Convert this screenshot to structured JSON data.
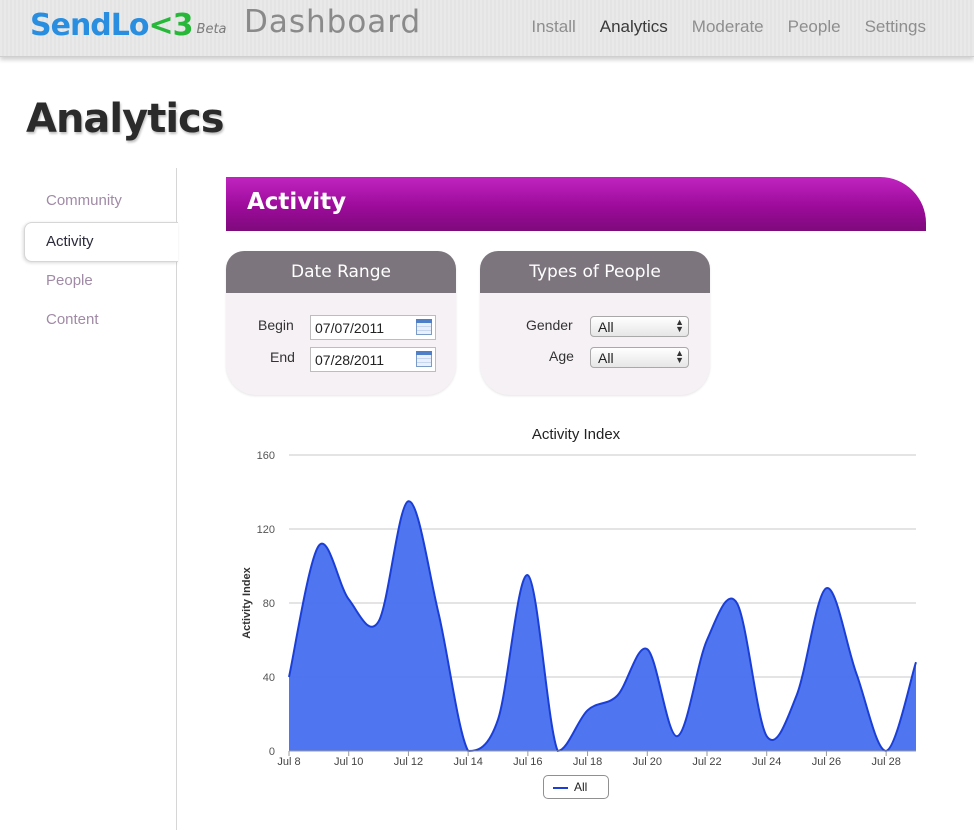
{
  "header": {
    "logo_text": "SendLo",
    "logo_heart": "<3",
    "logo_beta": "Beta",
    "app_title": "Dashboard",
    "nav": [
      {
        "label": "Install",
        "active": false
      },
      {
        "label": "Analytics",
        "active": true
      },
      {
        "label": "Moderate",
        "active": false
      },
      {
        "label": "People",
        "active": false
      },
      {
        "label": "Settings",
        "active": false
      }
    ]
  },
  "page": {
    "title": "Analytics"
  },
  "sidebar": {
    "items": [
      {
        "label": "Community",
        "active": false
      },
      {
        "label": "Activity",
        "active": true
      },
      {
        "label": "People",
        "active": false
      },
      {
        "label": "Content",
        "active": false
      }
    ]
  },
  "section": {
    "title": "Activity",
    "accent": "#9c0b9a"
  },
  "date_range": {
    "title": "Date Range",
    "begin_label": "Begin",
    "begin_value": "07/07/2011",
    "end_label": "End",
    "end_value": "07/28/2011",
    "icon": "calendar-icon"
  },
  "types_of_people": {
    "title": "Types of People",
    "gender_label": "Gender",
    "gender_value": "All",
    "age_label": "Age",
    "age_value": "All"
  },
  "chart_data": {
    "type": "area",
    "title": "Activity Index",
    "ylabel": "Activity Index",
    "xlabel": "",
    "ylim": [
      0,
      160
    ],
    "yticks": [
      0,
      40,
      80,
      120,
      160
    ],
    "xtick_labels": [
      "Jul 8",
      "Jul 10",
      "Jul 12",
      "Jul 14",
      "Jul 16",
      "Jul 18",
      "Jul 20",
      "Jul 22",
      "Jul 24",
      "Jul 26",
      "Jul 28"
    ],
    "x": [
      8,
      9,
      10,
      11,
      12,
      13,
      14,
      15,
      16,
      17,
      18,
      19,
      20,
      21,
      22,
      23,
      24,
      25,
      26,
      27,
      28,
      29
    ],
    "series": [
      {
        "name": "All",
        "color": "#4b72f0",
        "line_color": "#1b3fd6",
        "values": [
          40,
          111,
          82,
          70,
          135,
          75,
          0,
          17,
          95,
          0,
          22,
          30,
          55,
          8,
          60,
          80,
          8,
          30,
          88,
          42,
          0,
          48
        ]
      }
    ],
    "grid": true,
    "legend": "bottom-center"
  }
}
